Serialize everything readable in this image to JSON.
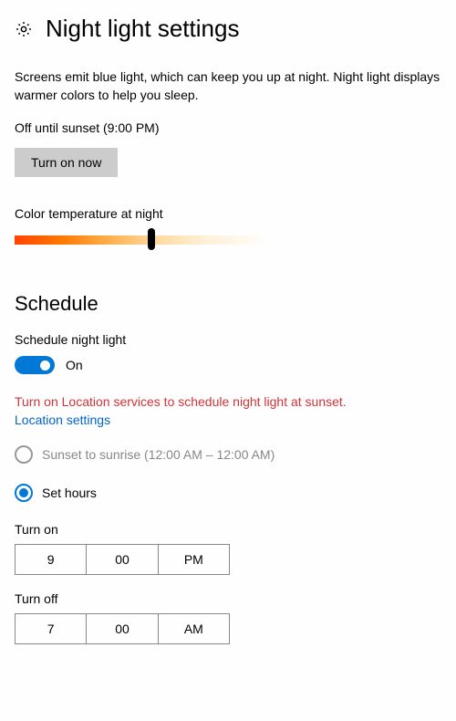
{
  "header": {
    "title": "Night light settings"
  },
  "description": "Screens emit blue light, which can keep you up at night. Night light displays warmer colors to help you sleep.",
  "status": "Off until sunset (9:00 PM)",
  "turn_on_button": "Turn on now",
  "color_temp_label": "Color temperature at night",
  "slider": {
    "value_percent": 52
  },
  "schedule": {
    "heading": "Schedule",
    "toggle_label": "Schedule night light",
    "toggle_state": "On",
    "warning": "Turn on Location services to schedule night light at sunset.",
    "location_link": "Location settings",
    "option_sunset": "Sunset to sunrise (12:00 AM – 12:00 AM)",
    "option_sethours": "Set hours",
    "turn_on_label": "Turn on",
    "turn_on": {
      "hour": "9",
      "minute": "00",
      "ampm": "PM"
    },
    "turn_off_label": "Turn off",
    "turn_off": {
      "hour": "7",
      "minute": "00",
      "ampm": "AM"
    }
  }
}
